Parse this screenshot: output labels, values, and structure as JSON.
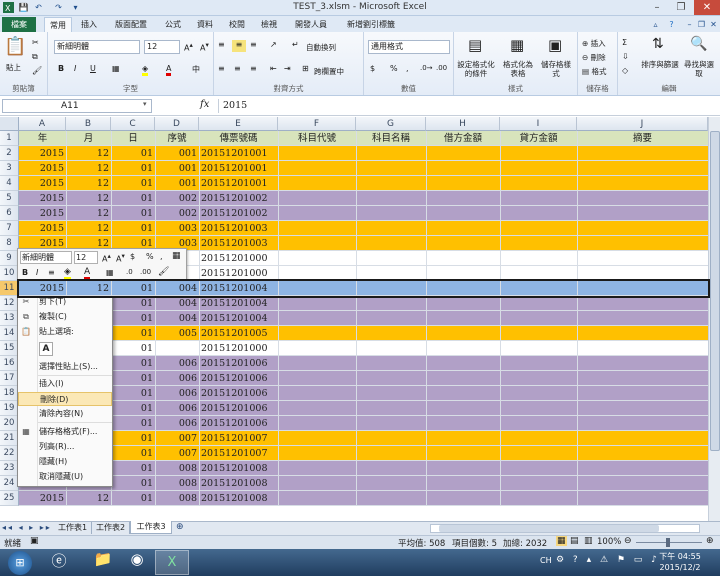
{
  "window": {
    "title": "TEST_3.xlsm - Microsoft Excel"
  },
  "tabs": [
    "檔案",
    "常用",
    "插入",
    "版面配置",
    "公式",
    "資料",
    "校閱",
    "檢視",
    "開發人員",
    "新增劉引標籤"
  ],
  "ribbon": {
    "clipboard": {
      "paste": "貼上",
      "label": "剪貼簿"
    },
    "font": {
      "name": "新細明體",
      "size": "12",
      "label": "字型"
    },
    "align": {
      "wrap": "自動換列",
      "merge": "跨欄置中",
      "label": "對齊方式"
    },
    "number": {
      "format": "通用格式",
      "label": "數值"
    },
    "styles": {
      "cond": "設定格式化的條件",
      "table": "格式化為表格",
      "cell": "儲存格樣式",
      "label": "樣式"
    },
    "cells": {
      "insert": "插入",
      "delete": "刪除",
      "format": "格式",
      "label": "儲存格"
    },
    "editing": {
      "sort": "排序與篩選",
      "find": "尋找與選取",
      "label": "編輯"
    }
  },
  "formula_bar": {
    "namebox": "A11",
    "fx": "fx",
    "content": "2015"
  },
  "columns": [
    "A",
    "B",
    "C",
    "D",
    "E",
    "F",
    "G",
    "H",
    "I",
    "J"
  ],
  "header_row": [
    "年",
    "月",
    "日",
    "序號",
    "傳票號碼",
    "科目代號",
    "科目名稱",
    "借方金額",
    "貸方金額",
    "摘要"
  ],
  "rows": [
    {
      "n": "2",
      "a": "2015",
      "b": "12",
      "c": "01",
      "d": "001",
      "e": "20151201001",
      "color": "#ffc000"
    },
    {
      "n": "3",
      "a": "2015",
      "b": "12",
      "c": "01",
      "d": "001",
      "e": "20151201001",
      "color": "#ffc000"
    },
    {
      "n": "4",
      "a": "2015",
      "b": "12",
      "c": "01",
      "d": "001",
      "e": "20151201001",
      "color": "#ffc000"
    },
    {
      "n": "5",
      "a": "2015",
      "b": "12",
      "c": "01",
      "d": "002",
      "e": "20151201002",
      "color": "#b1a0c7"
    },
    {
      "n": "6",
      "a": "2015",
      "b": "12",
      "c": "01",
      "d": "002",
      "e": "20151201002",
      "color": "#b1a0c7"
    },
    {
      "n": "7",
      "a": "2015",
      "b": "12",
      "c": "01",
      "d": "003",
      "e": "20151201003",
      "color": "#ffc000"
    },
    {
      "n": "8",
      "a": "2015",
      "b": "12",
      "c": "01",
      "d": "003",
      "e": "20151201003",
      "color": "#ffc000"
    },
    {
      "n": "9",
      "a": "",
      "b": "",
      "c": "",
      "d": "",
      "e": "20151201000",
      "color": "#ffffff"
    },
    {
      "n": "10",
      "a": "",
      "b": "",
      "c": "",
      "d": "",
      "e": "20151201000",
      "color": "#ffffff"
    },
    {
      "n": "11",
      "a": "2015",
      "b": "12",
      "c": "01",
      "d": "004",
      "e": "20151201004",
      "color": "#b1a0c7"
    },
    {
      "n": "12",
      "a": "",
      "b": "",
      "c": "01",
      "d": "004",
      "e": "20151201004",
      "color": "#b1a0c7"
    },
    {
      "n": "13",
      "a": "",
      "b": "",
      "c": "01",
      "d": "004",
      "e": "20151201004",
      "color": "#b1a0c7"
    },
    {
      "n": "14",
      "a": "",
      "b": "",
      "c": "01",
      "d": "005",
      "e": "20151201005",
      "color": "#ffc000"
    },
    {
      "n": "15",
      "a": "",
      "b": "",
      "c": "01",
      "d": "",
      "e": "20151201000",
      "color": "#ffffff"
    },
    {
      "n": "16",
      "a": "",
      "b": "",
      "c": "01",
      "d": "006",
      "e": "20151201006",
      "color": "#b1a0c7"
    },
    {
      "n": "17",
      "a": "",
      "b": "",
      "c": "01",
      "d": "006",
      "e": "20151201006",
      "color": "#b1a0c7"
    },
    {
      "n": "18",
      "a": "",
      "b": "",
      "c": "01",
      "d": "006",
      "e": "20151201006",
      "color": "#b1a0c7"
    },
    {
      "n": "19",
      "a": "",
      "b": "",
      "c": "01",
      "d": "006",
      "e": "20151201006",
      "color": "#b1a0c7"
    },
    {
      "n": "20",
      "a": "",
      "b": "",
      "c": "01",
      "d": "006",
      "e": "20151201006",
      "color": "#b1a0c7"
    },
    {
      "n": "21",
      "a": "",
      "b": "",
      "c": "01",
      "d": "007",
      "e": "20151201007",
      "color": "#ffc000"
    },
    {
      "n": "22",
      "a": "",
      "b": "",
      "c": "01",
      "d": "007",
      "e": "20151201007",
      "color": "#ffc000"
    },
    {
      "n": "23",
      "a": "",
      "b": "",
      "c": "01",
      "d": "008",
      "e": "20151201008",
      "color": "#b1a0c7"
    },
    {
      "n": "24",
      "a": "2015",
      "b": "12",
      "c": "01",
      "d": "008",
      "e": "20151201008",
      "color": "#b1a0c7"
    },
    {
      "n": "25",
      "a": "2015",
      "b": "12",
      "c": "01",
      "d": "008",
      "e": "20151201008",
      "color": "#b1a0c7"
    }
  ],
  "context_menu": [
    "剪下(T)",
    "複製(C)",
    "貼上選項:",
    "A",
    "選擇性貼上(S)...",
    "插入(I)",
    "刪除(D)",
    "清除內容(N)",
    "儲存格格式(F)...",
    "列高(R)...",
    "隱藏(H)",
    "取消隱藏(U)"
  ],
  "mini_toolbar": {
    "font": "新細明體",
    "size": "12"
  },
  "sheets": [
    "工作表1",
    "工作表2",
    "工作表3"
  ],
  "status": {
    "ready": "就緒",
    "avg": "平均值: 508",
    "count": "項目個數: 5",
    "sum": "加總: 2032",
    "zoom": "100%"
  },
  "taskbar": {
    "lang": "CH",
    "time": "下午 04:55",
    "date": "2015/12/2"
  },
  "colors": {
    "orange": "#ffc000",
    "purple": "#b1a0c7",
    "header_green": "#d8e4bc",
    "selected": "#8eb4e3"
  }
}
